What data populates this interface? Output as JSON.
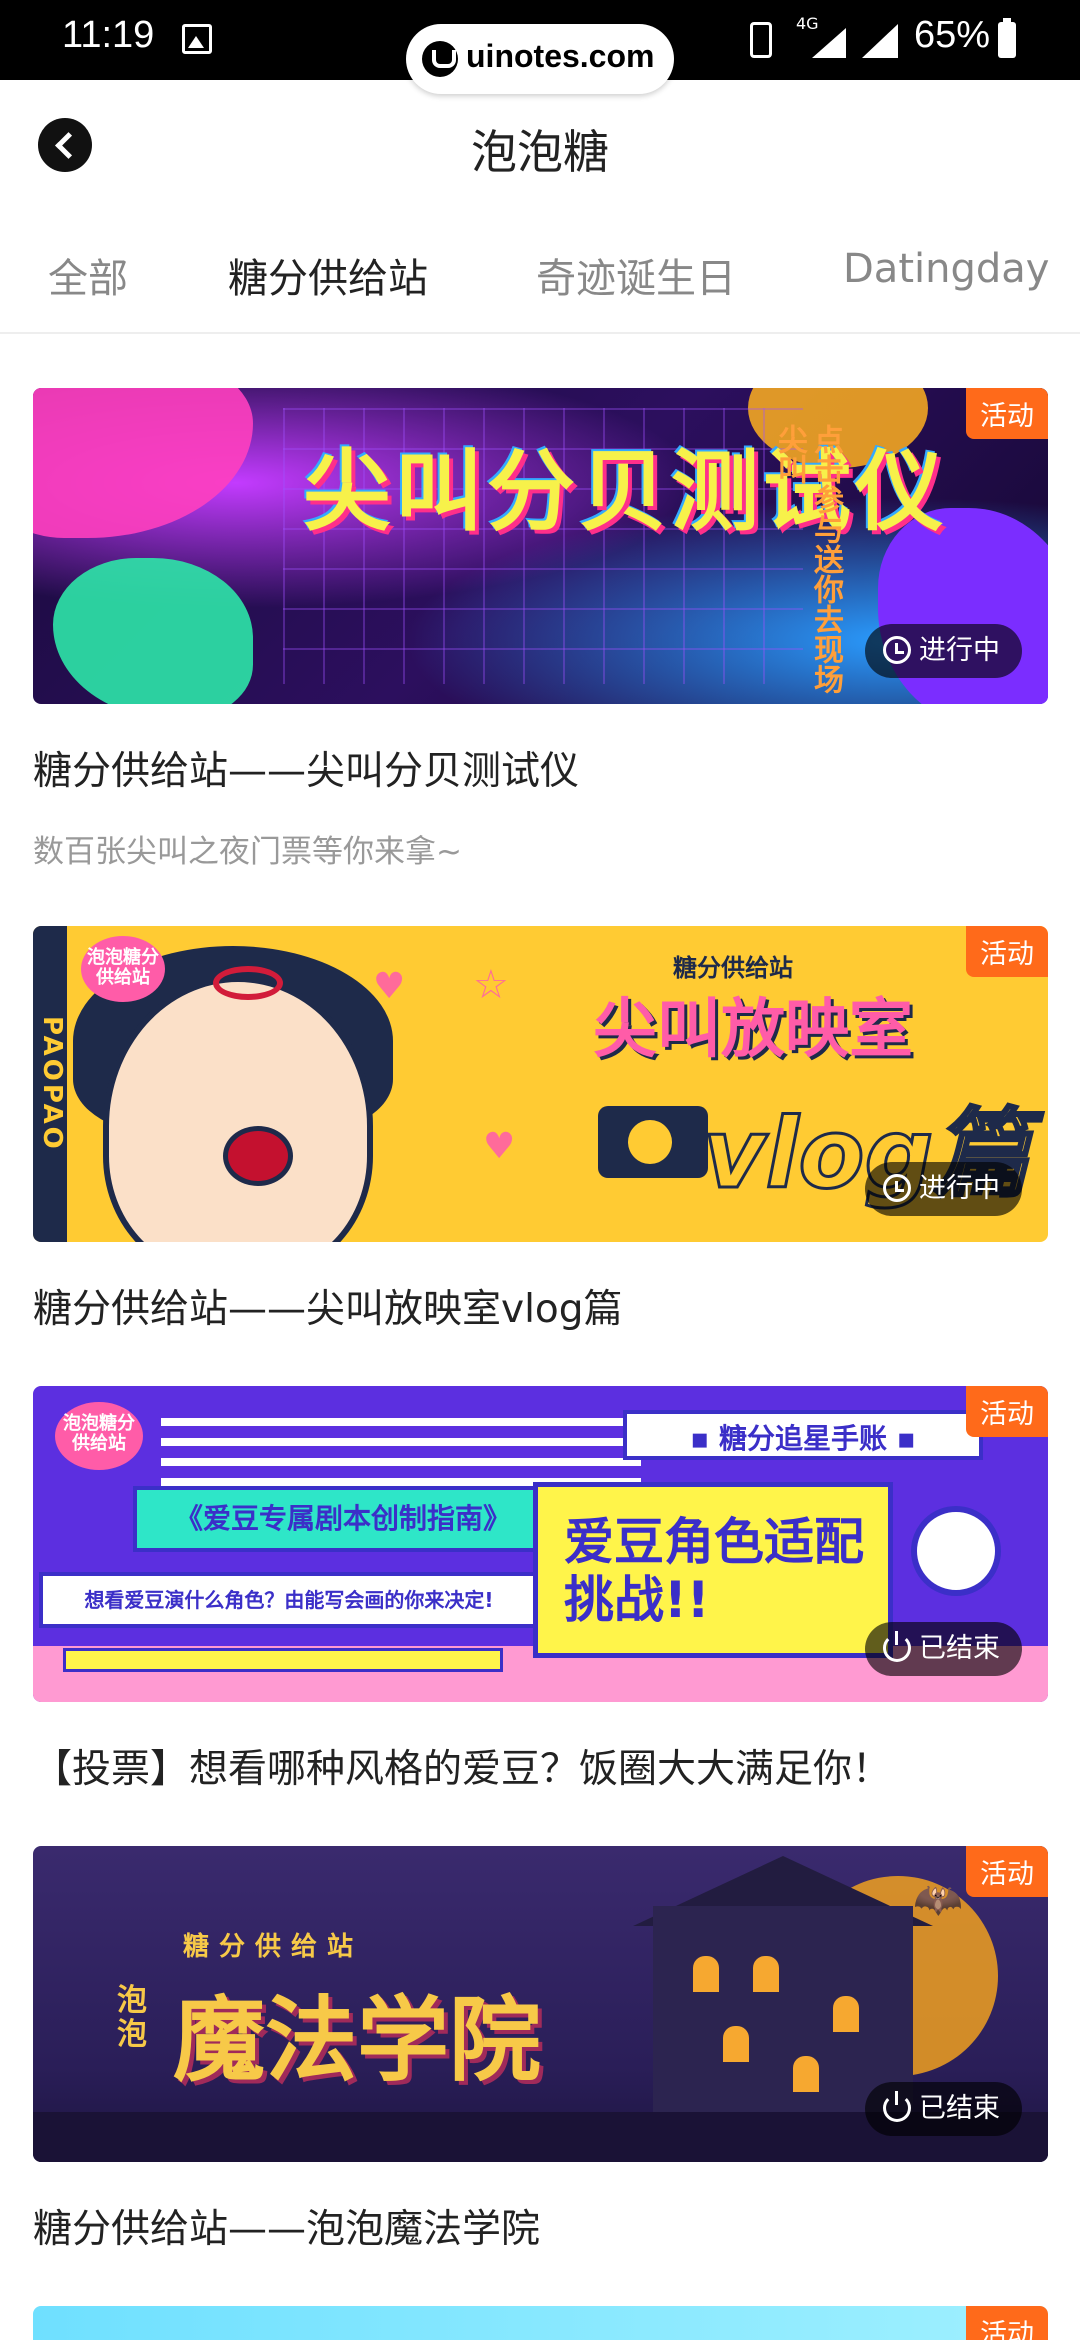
{
  "status_bar": {
    "time": "11:19",
    "site_badge": "uinotes.com",
    "network": "4G",
    "battery": "65%"
  },
  "nav": {
    "title": "泡泡糖"
  },
  "tabs": [
    {
      "label": "全部",
      "active": false
    },
    {
      "label": "糖分供给站",
      "active": true
    },
    {
      "label": "奇迹诞生日",
      "active": false
    },
    {
      "label": "Datingday",
      "active": false
    }
  ],
  "colors": {
    "activity_tag": "#ff6a1a",
    "active_tab": "#222222",
    "inactive_tab": "#888888"
  },
  "feed": [
    {
      "tag": "活动",
      "status": "进行中",
      "status_icon": "clock-icon",
      "banner_text_main": "尖叫分贝测试仪",
      "banner_text_side": "点击参与送你去现场尖叫",
      "title": "糖分供给站——尖叫分贝测试仪",
      "subtitle": "数百张尖叫之夜门票等你来拿~"
    },
    {
      "tag": "活动",
      "status": "进行中",
      "status_icon": "clock-icon",
      "banner_logo": "泡泡糖分供给站",
      "banner_stripe": "PAOPAO",
      "banner_small": "糖分供给站",
      "banner_text_main": "尖叫放映室",
      "banner_text_vlog": "vlog篇",
      "title": "糖分供给站——尖叫放映室vlog篇",
      "subtitle": ""
    },
    {
      "tag": "活动",
      "status": "已结束",
      "status_icon": "power-icon",
      "banner_logo": "泡泡糖分供给站",
      "banner_box_top": "▪ 糖分追星手账 ▪",
      "banner_guide": "《爱豆专属剧本创制指南》",
      "banner_desc": "想看爱豆演什么角色？由能写会画的你来决定!",
      "banner_main": "爱豆角色适配挑战!!",
      "title": "【投票】想看哪种风格的爱豆？饭圈大大满足你！",
      "subtitle": ""
    },
    {
      "tag": "活动",
      "status": "已结束",
      "status_icon": "power-icon",
      "banner_small": "糖分供给站",
      "banner_small_side": "泡泡",
      "banner_text_main": "魔法学院",
      "title": "糖分供给站——泡泡魔法学院",
      "subtitle": ""
    },
    {
      "tag": "活动"
    }
  ]
}
